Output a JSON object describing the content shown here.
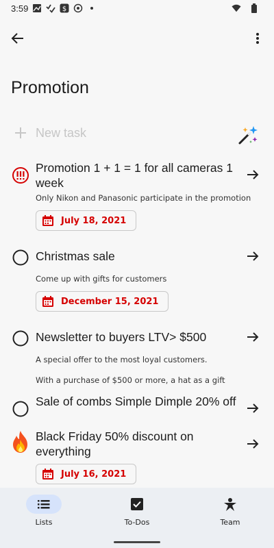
{
  "status_bar": {
    "time": "3:59"
  },
  "page": {
    "title": "Promotion"
  },
  "new_task": {
    "placeholder": "New task"
  },
  "tasks": [
    {
      "title": "Promotion 1 + 1 = 1 for all cameras 1 week",
      "notes": [
        "Only Nikon and Panasonic participate in the promotion"
      ],
      "date": "July 18, 2021",
      "lead_icon": "priority-exclamation-icon"
    },
    {
      "title": "Christmas sale",
      "notes": [
        "Come up with gifts for customers"
      ],
      "date": "December 15, 2021",
      "lead_icon": "circle-checkbox-icon"
    },
    {
      "title": "Newsletter to buyers LTV> $500",
      "notes": [
        "A special offer to the most loyal customers.",
        "With a purchase of $500 or more, a hat as a gift"
      ],
      "lead_icon": "circle-checkbox-icon"
    },
    {
      "title": "Sale of combs Simple Dimple 20% off",
      "notes": [],
      "lead_icon": "circle-checkbox-icon"
    },
    {
      "title": "Black Friday 50% discount on everything",
      "notes": [],
      "date": "July 16, 2021",
      "lead_icon": "fire-icon"
    }
  ],
  "bottom_nav": {
    "lists": "Lists",
    "todos": "To-Dos",
    "team": "Team",
    "active": "lists"
  },
  "colors": {
    "accent_red": "#d50000",
    "nav_active_pill": "#d6e3fb",
    "nav_background": "#eceff3"
  }
}
